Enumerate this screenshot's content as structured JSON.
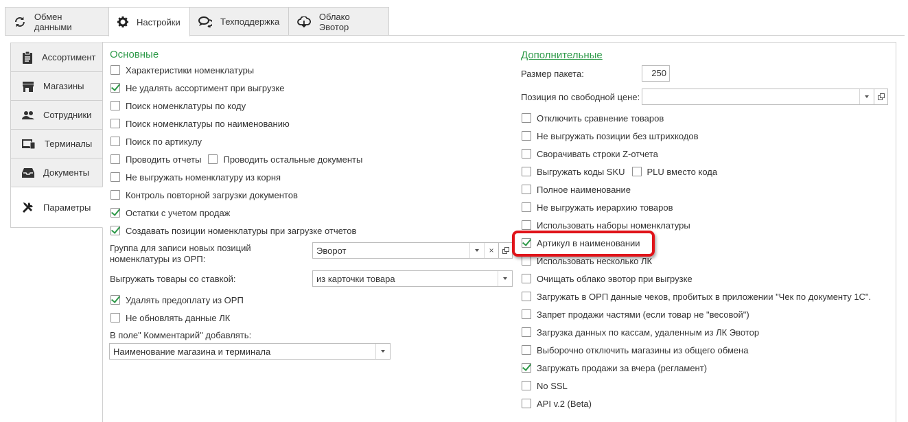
{
  "top_tabs": [
    {
      "label": "Обмен данными",
      "icon": "sync-icon"
    },
    {
      "label": "Настройки",
      "icon": "gear-icon"
    },
    {
      "label": "Техподдержка",
      "icon": "chat-icon"
    },
    {
      "label": "Облако Эвотор",
      "icon": "cloud-icon"
    }
  ],
  "side_tabs": [
    {
      "label": "Ассортимент",
      "icon": "clipboard-icon"
    },
    {
      "label": "Магазины",
      "icon": "store-icon"
    },
    {
      "label": "Сотрудники",
      "icon": "people-icon"
    },
    {
      "label": "Терминалы",
      "icon": "devices-icon"
    },
    {
      "label": "Документы",
      "icon": "inbox-icon"
    },
    {
      "label": "Параметры",
      "icon": "tools-icon"
    }
  ],
  "left": {
    "title": "Основные",
    "checkboxes": [
      {
        "label": "Характеристики номенклатуры",
        "checked": false
      },
      {
        "label": "Не удалять ассортимент при выгрузке",
        "checked": true
      },
      {
        "label": "Поиск номенклатуры по коду",
        "checked": false
      },
      {
        "label": "Поиск номенклатуры по наименованию",
        "checked": false
      },
      {
        "label": "Поиск по артикулу",
        "checked": false
      },
      {
        "label": "Проводить отчеты",
        "checked": false
      },
      {
        "label": "Не выгружать номенклатуру из корня",
        "checked": false
      },
      {
        "label": "Контроль повторной загрузки документов",
        "checked": false
      },
      {
        "label": "Остатки с учетом продаж",
        "checked": true
      },
      {
        "label": "Создавать позиции номенклатуры при загрузке отчетов",
        "checked": true
      }
    ],
    "other_docs_label": "Проводить остальные документы",
    "group_label_line1": "Группа для записи новых позиций",
    "group_label_line2": "номенклатуры из ОРП:",
    "group_value": "Эворот",
    "rate_label": "Выгружать товары со ставкой:",
    "rate_value": "из карточки товара",
    "delete_prepay_label": "Удалять предоплату из ОРП",
    "no_update_lk_label": "Не обновлять данные ЛК",
    "comment_label": "В поле\" Комментарий\" добавлять:",
    "comment_value": "Наименование магазина и терминала"
  },
  "right": {
    "title": "Дополнительные",
    "packet_label": "Размер пакета:",
    "packet_value": "250",
    "free_price_label": "Позиция по свободной цене:",
    "free_price_value": "",
    "checkboxes": [
      {
        "label": "Отключить сравнение товаров",
        "checked": false
      },
      {
        "label": "Не выгружать позиции без штрихкодов",
        "checked": false
      },
      {
        "label": "Сворачивать строки Z-отчета",
        "checked": false
      },
      {
        "label": "Выгружать коды SKU",
        "checked": false
      },
      {
        "label": "Полное наименование",
        "checked": false
      },
      {
        "label": "Не выгружать иерархию товаров",
        "checked": false
      },
      {
        "label": "Использовать наборы номенклатуры",
        "checked": false
      },
      {
        "label": "Артикул в наименовании",
        "checked": true
      },
      {
        "label": "Использовать несколько ЛК",
        "checked": false
      },
      {
        "label": "Очищать облако эвотор при выгрузке",
        "checked": false
      },
      {
        "label": "Загружать в ОРП данные  чеков, пробитых в приложении  \"Чек по документу 1С\".",
        "checked": false
      },
      {
        "label": "Запрет продажи частями (если товар не \"весовой\")",
        "checked": false
      },
      {
        "label": "Загрузка данных по кассам, удаленным из ЛК Эвотор",
        "checked": false
      },
      {
        "label": "Выборочно отключить магазины из общего обмена",
        "checked": false
      },
      {
        "label": "Загружать продажи за вчера (регламент)",
        "checked": true
      },
      {
        "label": "No SSL",
        "checked": false
      },
      {
        "label": "API v.2 (Beta)",
        "checked": false
      }
    ],
    "plu_label": "PLU вместо кода"
  },
  "colors": {
    "accent": "#2e9a49",
    "highlight": "#e0141a"
  }
}
